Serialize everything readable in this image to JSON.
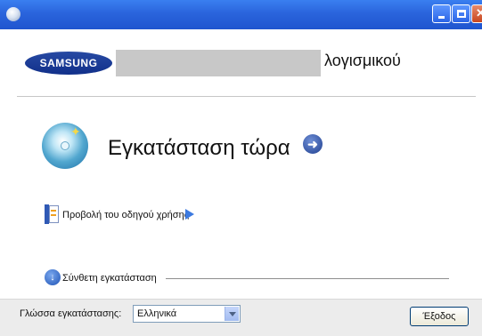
{
  "window": {
    "icons": {
      "system": "setup-cd-icon",
      "minimize": "minimize-icon",
      "maximize": "maximize-icon",
      "close": "close-icon"
    }
  },
  "banner": {
    "logo_text": "SAMSUNG",
    "title": "λογισμικού"
  },
  "main": {
    "install_now": "Εγκατάσταση τώρα",
    "install_icon": "software-disc-icon",
    "go_icon": "arrow-right-circle-icon",
    "user_guide_link": "Προβολή του οδηγού χρήσης",
    "user_guide_icon": "manual-book-icon",
    "advanced_install": "Σύνθετη εγκατάσταση",
    "advanced_icon": "chevron-down-circle-icon"
  },
  "footer": {
    "language_label": "Γλώσσα εγκατάστασης:",
    "language_value": "Ελληνικά",
    "exit_button": "Έξοδος"
  },
  "colors": {
    "titlebar": "#2a64dc",
    "logo": "#1a3a96",
    "footer": "#ececec",
    "link_arrow": "#3c7ae0"
  }
}
